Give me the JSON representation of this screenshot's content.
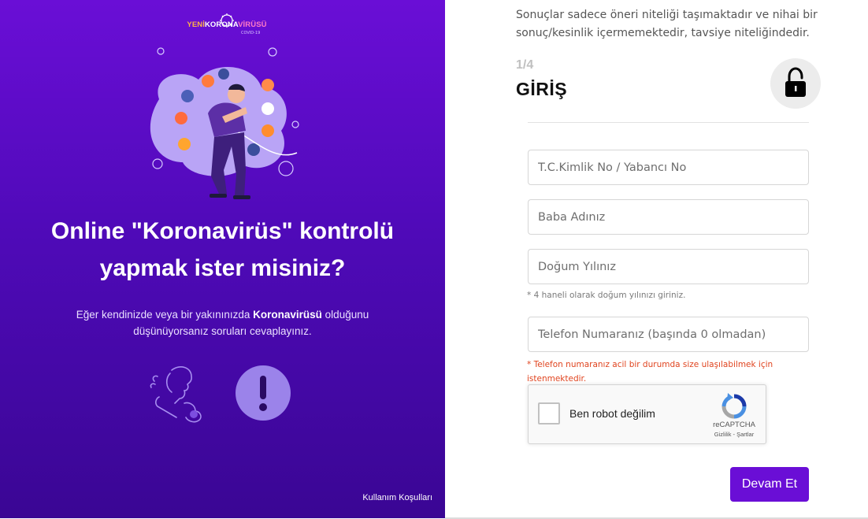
{
  "left_panel": {
    "logo": {
      "text_a": "YENİ",
      "text_b": "KORONA",
      "text_c": "VİRÜSÜ",
      "sub": "COVID-19"
    },
    "headline_line1": "Online \"Koronavirüs\" kontrolü",
    "headline_line2": "yapmak ister misiniz?",
    "subtext_before": "Eğer kendinizde veya bir yakınınızda ",
    "subtext_bold": "Koronavirüsü",
    "subtext_after": " olduğunu düşünüyorsanız soruları cevaplayınız.",
    "alert_symbol": "!",
    "terms_link": "Kullanım Koşulları",
    "colors": {
      "gradient_top": "#6a0ed6",
      "gradient_bottom": "#3a0694",
      "alert_circle": "#9b83ea"
    }
  },
  "form": {
    "disclaimer": "Sonuçlar sadece öneri niteliği taşımaktadır ve nihai bir sonuç/kesinlik içermemektedir, tavsiye niteliğindedir.",
    "step": "1/4",
    "title": "GİRİŞ",
    "lock_icon": "lock-icon",
    "fields": {
      "tc": {
        "placeholder": "T.C.Kimlik No / Yabancı No",
        "value": ""
      },
      "father_name": {
        "placeholder": "Baba Adınız",
        "value": ""
      },
      "birth_year": {
        "placeholder": "Doğum Yılınız",
        "value": "",
        "hint": "* 4 haneli olarak doğum yılınızı giriniz."
      },
      "phone": {
        "placeholder": "Telefon Numaranız (başında 0 olmadan)",
        "value": "",
        "hint": "* Telefon numaranız acil bir durumda size ulaşılabilmek için istenmektedir."
      }
    },
    "captcha": {
      "label": "Ben robot değilim",
      "brand": "reCAPTCHA",
      "links": "Gizlilik - Şartlar"
    },
    "submit_label": "Devam Et",
    "colors": {
      "accent": "#6a0ed6",
      "hint_error": "#e0441f"
    }
  }
}
